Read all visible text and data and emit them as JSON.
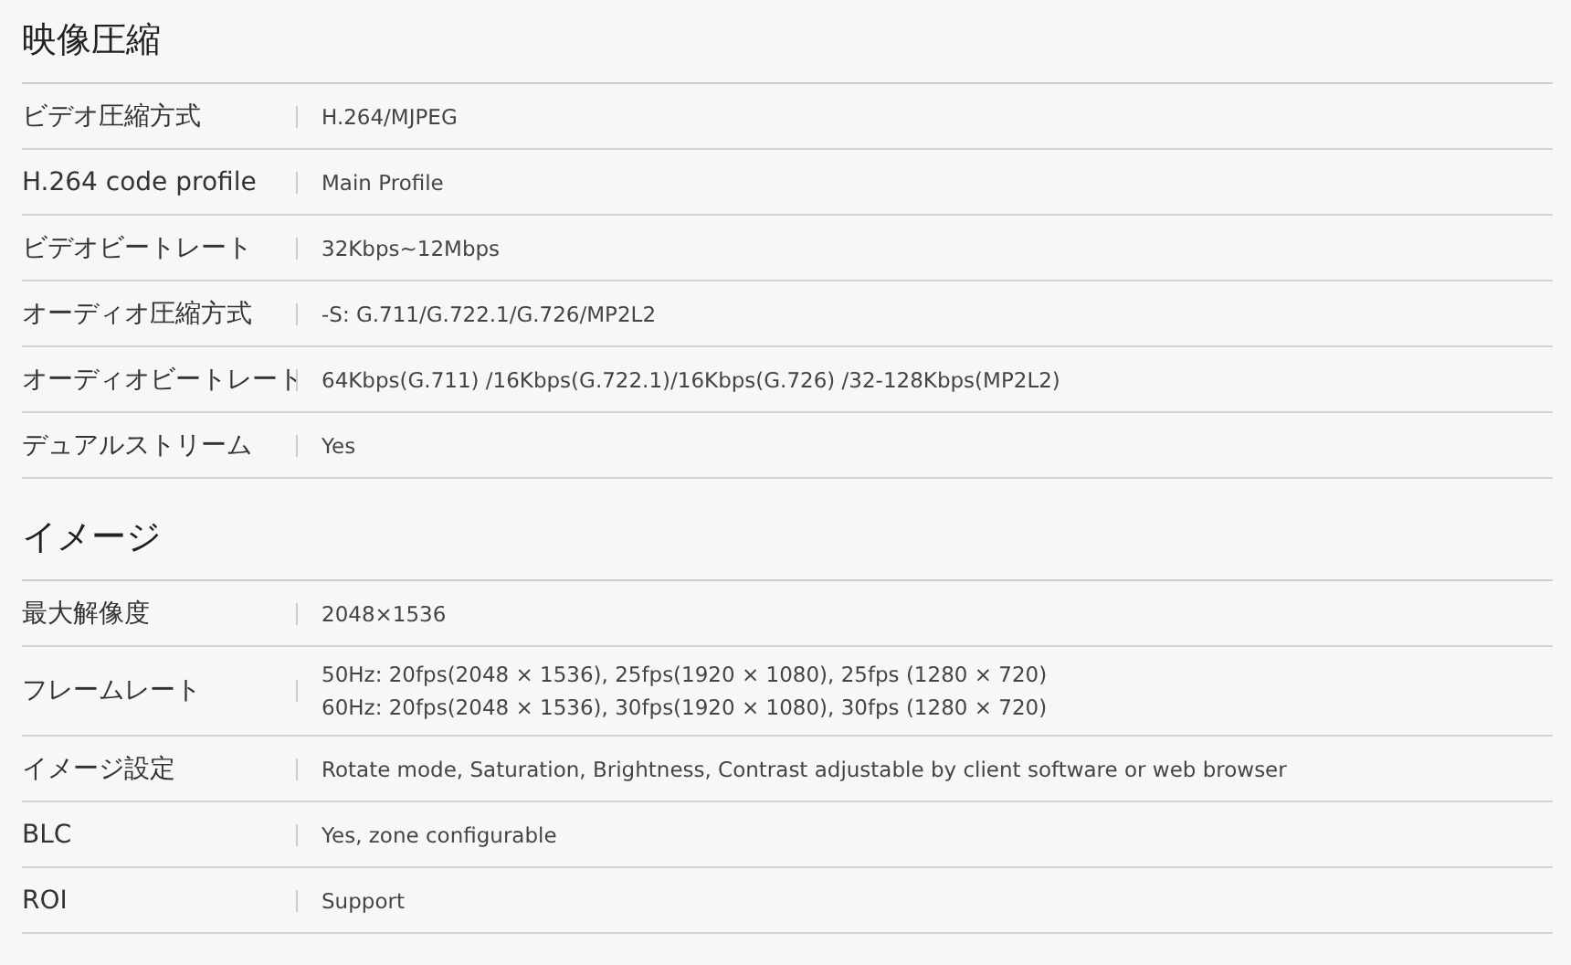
{
  "sections": [
    {
      "title": "映像圧縮",
      "rows": [
        {
          "label": "ビデオ圧縮方式",
          "lines": [
            "H.264/MJPEG"
          ]
        },
        {
          "label": "H.264 code profile",
          "lines": [
            "Main Profile"
          ]
        },
        {
          "label": "ビデオビートレート",
          "lines": [
            "32Kbps~12Mbps"
          ]
        },
        {
          "label": "オーディオ圧縮方式",
          "lines": [
            "-S: G.711/G.722.1/G.726/MP2L2"
          ]
        },
        {
          "label": "オーディオビートレート",
          "lines": [
            "64Kbps(G.711) /16Kbps(G.722.1)/16Kbps(G.726) /32-128Kbps(MP2L2)"
          ]
        },
        {
          "label": "デュアルストリーム",
          "lines": [
            "Yes"
          ]
        }
      ]
    },
    {
      "title": "イメージ",
      "rows": [
        {
          "label": "最大解像度",
          "lines": [
            "2048×1536"
          ]
        },
        {
          "label": "フレームレート",
          "lines": [
            "50Hz: 20fps(2048 × 1536), 25fps(1920 × 1080), 25fps (1280 × 720)",
            "60Hz: 20fps(2048 × 1536), 30fps(1920 × 1080), 30fps (1280 × 720)"
          ]
        },
        {
          "label": "イメージ設定",
          "lines": [
            "Rotate mode, Saturation, Brightness, Contrast adjustable by client software or web browser"
          ]
        },
        {
          "label": "BLC",
          "lines": [
            "Yes, zone configurable"
          ]
        },
        {
          "label": "ROI",
          "lines": [
            "Support"
          ]
        }
      ]
    }
  ]
}
